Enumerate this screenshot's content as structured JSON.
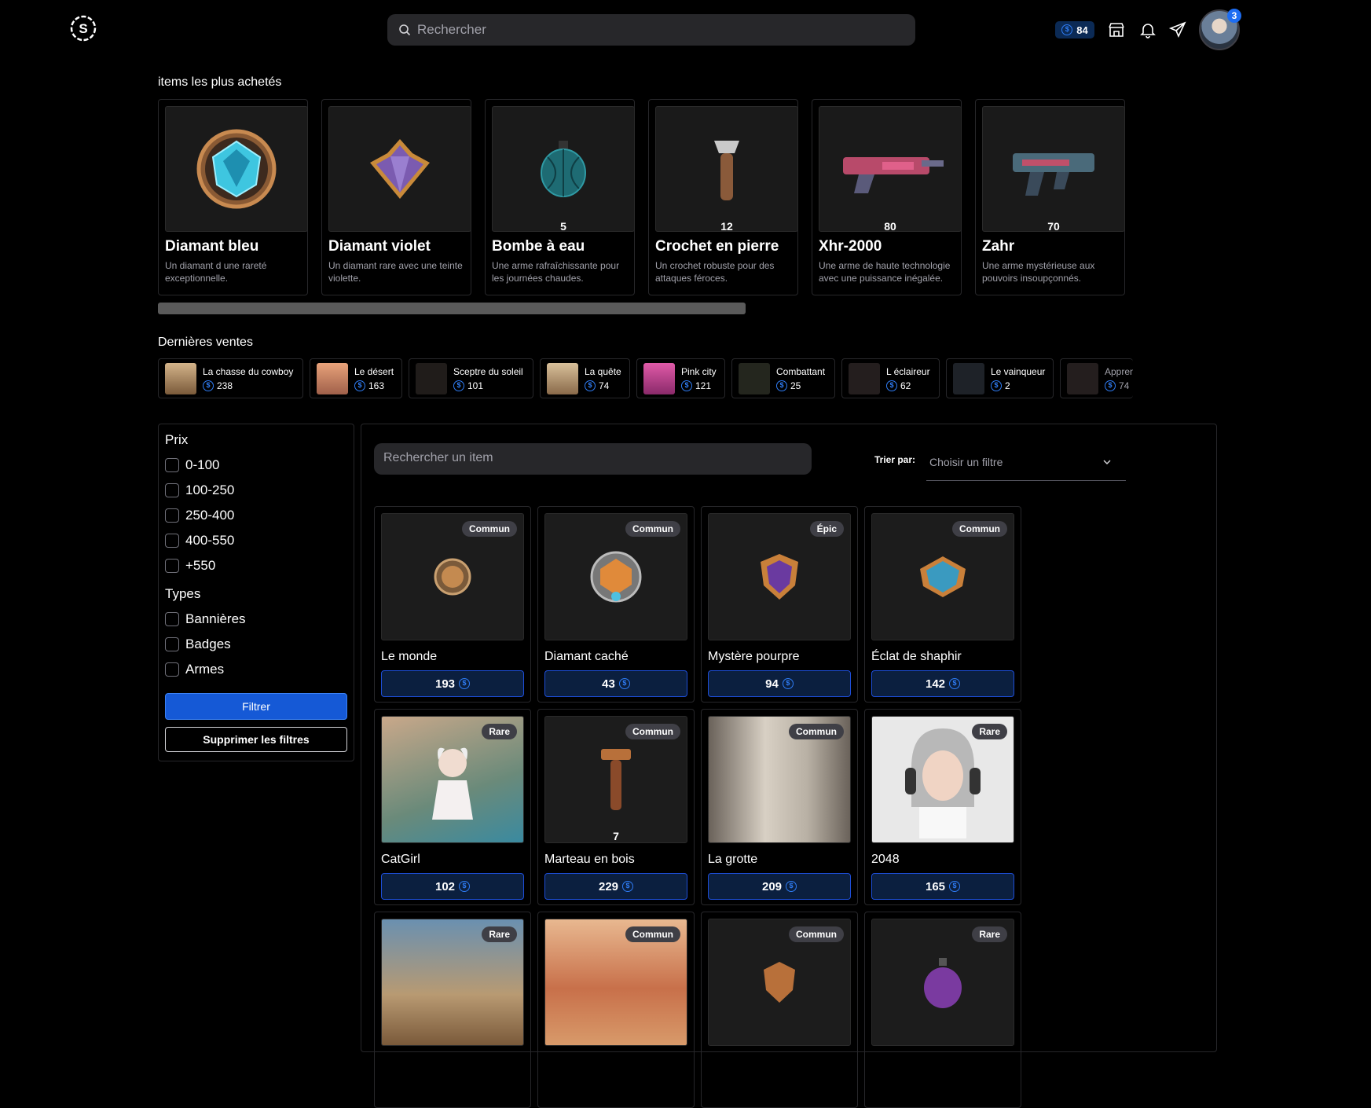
{
  "header": {
    "search_placeholder": "Rechercher",
    "coins": "84",
    "notifications": "3"
  },
  "top_items": {
    "title": "items les plus achetés",
    "items": [
      {
        "name": "Diamant bleu",
        "desc": "Un diamant d une rareté exceptionnelle.",
        "qty": "",
        "icon": "blue-gem-badge-icon"
      },
      {
        "name": "Diamant violet",
        "desc": "Un diamant rare avec une teinte violette.",
        "qty": "",
        "icon": "violet-diamond-icon"
      },
      {
        "name": "Bombe à eau",
        "desc": "Une arme rafraîchissante pour les journées chaudes.",
        "qty": "5",
        "icon": "water-bomb-icon"
      },
      {
        "name": "Crochet en pierre",
        "desc": "Un crochet robuste pour des attaques féroces.",
        "qty": "12",
        "icon": "stone-hook-icon"
      },
      {
        "name": "Xhr-2000",
        "desc": "Une arme de haute technologie avec une puissance inégalée.",
        "qty": "80",
        "icon": "pink-blaster-icon"
      },
      {
        "name": "Zahr",
        "desc": "Une arme mystérieuse aux pouvoirs insoupçonnés.",
        "qty": "70",
        "icon": "blue-blaster-icon"
      }
    ]
  },
  "sales": {
    "title": "Dernières ventes",
    "items": [
      {
        "name": "La chasse du cowboy",
        "price": "238",
        "color": "#a07a52"
      },
      {
        "name": "Le désert",
        "price": "163",
        "color": "#c98a6a"
      },
      {
        "name": "Sceptre du soleil",
        "price": "101",
        "color": "#2a2420"
      },
      {
        "name": "La quête",
        "price": "74",
        "color": "#b89a72"
      },
      {
        "name": "Pink city",
        "price": "121",
        "color": "#c4569e"
      },
      {
        "name": "Combattant",
        "price": "25",
        "color": "#2a2d22"
      },
      {
        "name": "L éclaireur",
        "price": "62",
        "color": "#2a2020"
      },
      {
        "name": "Le vainqueur",
        "price": "2",
        "color": "#20262e"
      },
      {
        "name": "Apprenti",
        "price": "74",
        "color": "#2a2020"
      }
    ]
  },
  "filters": {
    "price_title": "Prix",
    "prices": [
      "0-100",
      "100-250",
      "250-400",
      "400-550",
      "+550"
    ],
    "types_title": "Types",
    "types": [
      "Bannières",
      "Badges",
      "Armes"
    ],
    "filter_btn": "Filtrer",
    "clear_btn": "Supprimer les filtres"
  },
  "shop": {
    "search_placeholder": "Rechercher un item",
    "sort_label": "Trier par:",
    "sort_value": "Choisir un filtre",
    "items": [
      {
        "name": "Le monde",
        "price": "193",
        "rarity": "Commun",
        "qty": ""
      },
      {
        "name": "Diamant caché",
        "price": "43",
        "rarity": "Commun",
        "qty": ""
      },
      {
        "name": "Mystère pourpre",
        "price": "94",
        "rarity": "Épic",
        "qty": ""
      },
      {
        "name": "Éclat de shaphir",
        "price": "142",
        "rarity": "Commun",
        "qty": ""
      },
      {
        "name": "CatGirl",
        "price": "102",
        "rarity": "Rare",
        "qty": ""
      },
      {
        "name": "Marteau en bois",
        "price": "229",
        "rarity": "Commun",
        "qty": "7"
      },
      {
        "name": "La grotte",
        "price": "209",
        "rarity": "Commun",
        "qty": ""
      },
      {
        "name": "2048",
        "price": "165",
        "rarity": "Rare",
        "qty": ""
      },
      {
        "name": "",
        "price": "",
        "rarity": "Rare",
        "qty": ""
      },
      {
        "name": "",
        "price": "",
        "rarity": "Commun",
        "qty": ""
      },
      {
        "name": "",
        "price": "",
        "rarity": "Commun",
        "qty": ""
      },
      {
        "name": "",
        "price": "",
        "rarity": "Rare",
        "qty": ""
      }
    ]
  }
}
